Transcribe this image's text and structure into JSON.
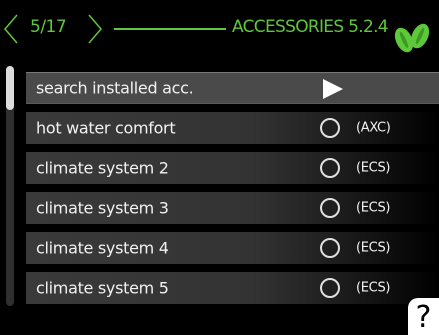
{
  "header": {
    "page_counter": "5/17",
    "title": "ACCESSORIES 5.2.4"
  },
  "menu": {
    "items": [
      {
        "label": "search installed acc.",
        "type": "action",
        "selected": true
      },
      {
        "label": "hot water comfort",
        "tag": "(AXC)",
        "checked": false
      },
      {
        "label": "climate system 2",
        "tag": "(ECS)",
        "checked": false
      },
      {
        "label": "climate system 3",
        "tag": "(ECS)",
        "checked": false
      },
      {
        "label": "climate system 4",
        "tag": "(ECS)",
        "checked": false
      },
      {
        "label": "climate system 5",
        "tag": "(ECS)",
        "checked": false
      }
    ]
  },
  "help": {
    "label": "?"
  },
  "colors": {
    "accent": "#5ec83a",
    "background": "#000000",
    "row": "#3a3a3a",
    "row_selected": "#4a4a4a"
  },
  "icons": {
    "nav_left": "chevron-left-icon",
    "nav_right": "chevron-right-icon",
    "brand": "leaf-icon",
    "action": "play-arrow-icon",
    "radio": "radio-unchecked-icon"
  }
}
